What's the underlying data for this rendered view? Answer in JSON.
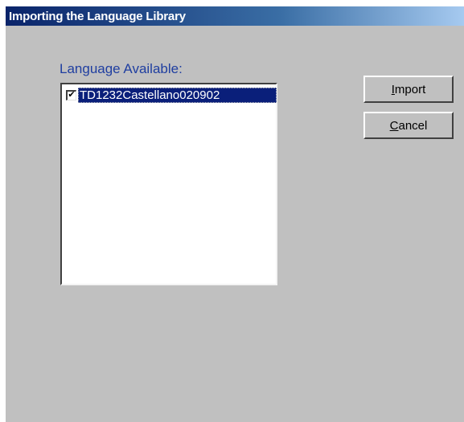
{
  "window": {
    "title": "Importing the Language Library"
  },
  "language_list": {
    "label": "Language Available:",
    "items": [
      {
        "name": "TD1232Castellano020902",
        "checked": true,
        "selected": true
      }
    ]
  },
  "buttons": {
    "import": {
      "accel": "I",
      "rest": "mport"
    },
    "cancel": {
      "accel": "C",
      "rest": "ancel"
    }
  },
  "colors": {
    "title_start": "#0a246a",
    "title_end": "#a6caf0",
    "dialog_bg": "#c0c0c0",
    "label": "#1f3ea0",
    "selection": "#0a1f7a"
  },
  "icons": {
    "checkbox_mark": "checkmark-icon"
  }
}
